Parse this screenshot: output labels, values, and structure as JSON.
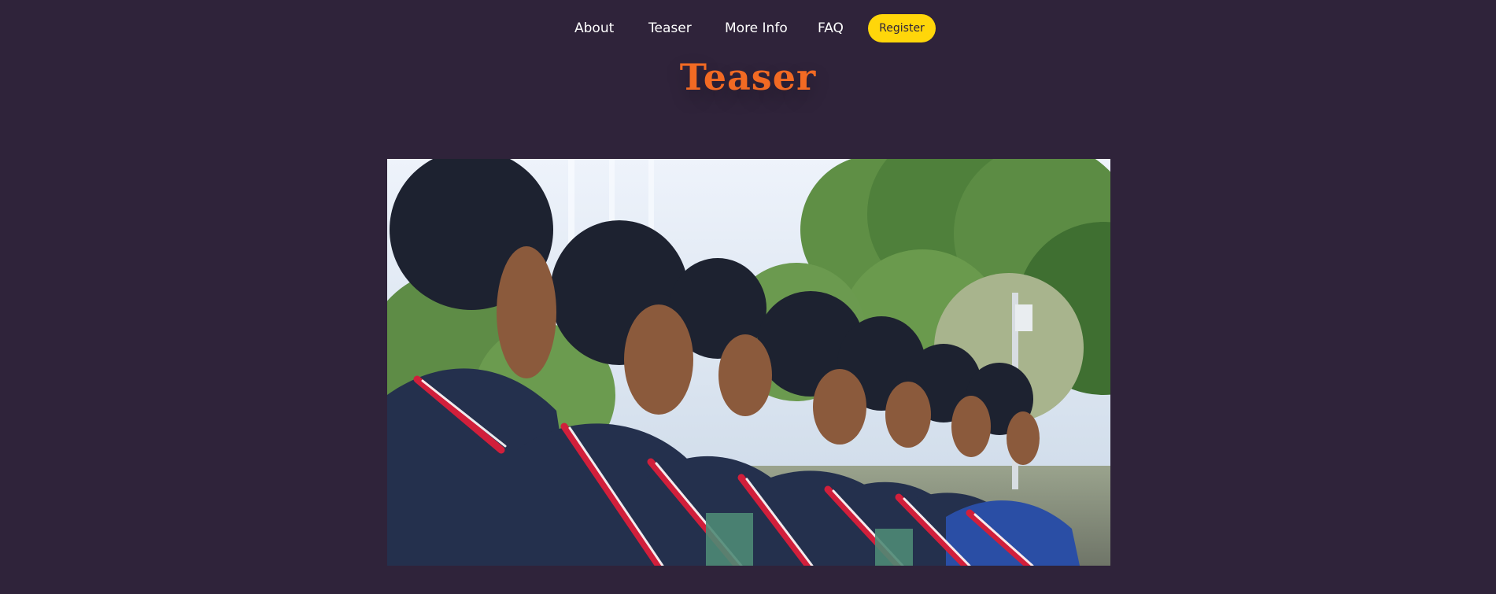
{
  "nav": {
    "items": [
      {
        "label": "About"
      },
      {
        "label": "Teaser"
      },
      {
        "label": "More Info"
      },
      {
        "label": "FAQ"
      }
    ],
    "register_label": "Register"
  },
  "section": {
    "title": "Teaser"
  },
  "colors": {
    "background": "#2f233a",
    "accent": "#f26a23",
    "button": "#ffd60a"
  }
}
